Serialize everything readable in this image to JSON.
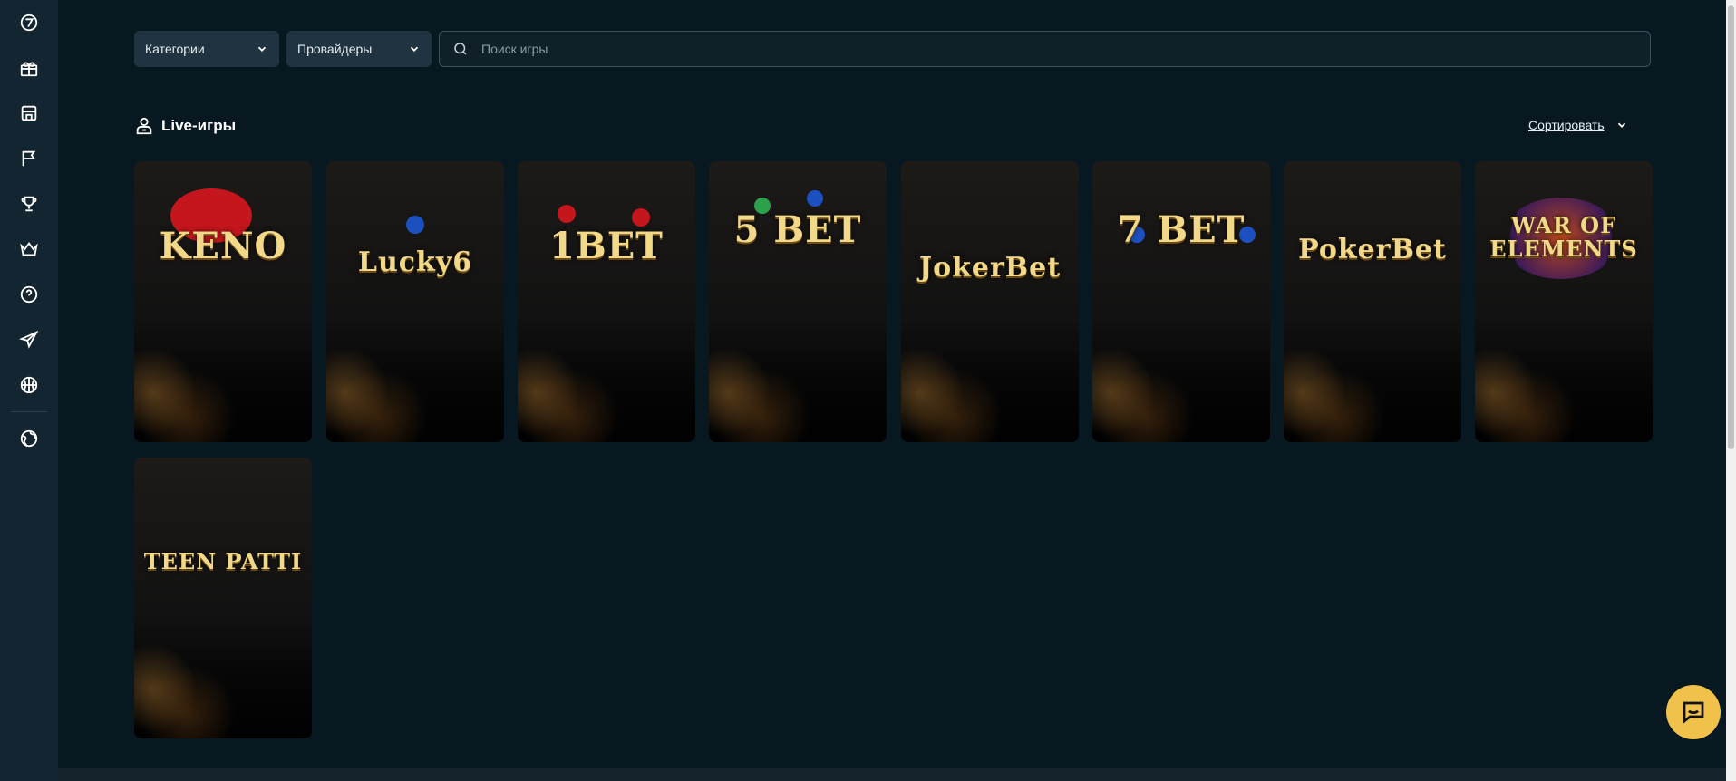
{
  "sidebar": {
    "items": [
      {
        "icon": "seven-logo-icon"
      },
      {
        "icon": "gift-icon"
      },
      {
        "icon": "casino-building-icon"
      },
      {
        "icon": "flags-icon"
      },
      {
        "icon": "trophy-icon"
      },
      {
        "icon": "crown-icon"
      },
      {
        "icon": "help-icon"
      },
      {
        "icon": "telegram-icon"
      },
      {
        "icon": "sports-ball-icon"
      },
      {
        "icon": "language-globe-icon"
      }
    ]
  },
  "filters": {
    "categories_label": "Категории",
    "providers_label": "Провайдеры",
    "search_placeholder": "Поиск игры"
  },
  "section": {
    "title": "Live-игры",
    "sort_label": "Сортировать"
  },
  "games": [
    {
      "title": "KENO"
    },
    {
      "title": "Lucky6"
    },
    {
      "title": "1BET"
    },
    {
      "title": "5 BET"
    },
    {
      "title": "JokerBet"
    },
    {
      "title": "7 BET"
    },
    {
      "title": "PokerBet"
    },
    {
      "title": "WAR OF ELEMENTS"
    },
    {
      "title": "TEEN PATTI"
    }
  ],
  "colors": {
    "background": "#081820",
    "sidebar": "#132530",
    "filter_bg": "#1f3440",
    "accent_gold": "#f0c14b"
  }
}
